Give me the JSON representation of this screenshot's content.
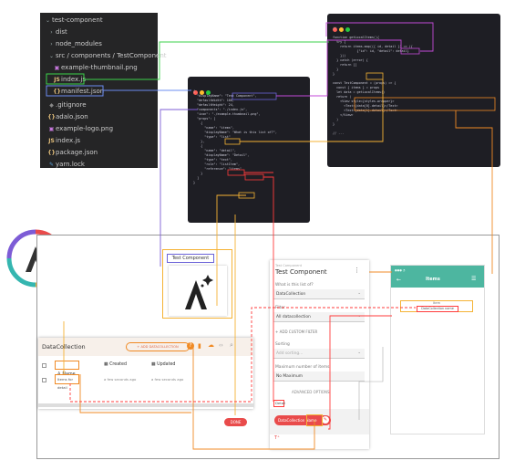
{
  "colors": {
    "teal": "#4db6a0",
    "orange": "#f08a24",
    "red": "#ff3b3b",
    "code_bg": "#1e1e24",
    "tree_bg": "#252526"
  },
  "file_tree": {
    "root": "test-component",
    "items": [
      {
        "label": "dist",
        "icon": "chevron-right"
      },
      {
        "label": "node_modules",
        "icon": "chevron-right"
      },
      {
        "label": "src / components / TestComponent",
        "icon": "chevron-down"
      },
      {
        "label": "example-thumbnail.png",
        "icon": "image"
      },
      {
        "label": "index.js",
        "icon": "js"
      },
      {
        "label": "manifest.json",
        "icon": "json"
      },
      {
        "label": ".gitignore",
        "icon": "git"
      },
      {
        "label": "adalo.json",
        "icon": "json"
      },
      {
        "label": "example-logo.png",
        "icon": "image"
      },
      {
        "label": "index.js",
        "icon": "js"
      },
      {
        "label": "package.json",
        "icon": "json"
      },
      {
        "label": "yarn.lock",
        "icon": "yarn"
      }
    ]
  },
  "manifest_code": [
    "{",
    "  \"displayName\": \"Test Component\",",
    "  \"defaultWidth\": 100,",
    "  \"defaultHeight\": 24,",
    "  \"components\": \"./index.js\",",
    "  \"icon\": \"./example-thumbnail.png\",",
    "  \"props\": [",
    "    {",
    "      \"name\": \"items\",",
    "      \"displayName\": \"What is this list of?\",",
    "      \"type\": \"list\"",
    "    },",
    "    {",
    "      \"name\": \"detail\",",
    "      \"displayName\": \"Detail\",",
    "      \"type\": \"text\",",
    "      \"role\": \"listItem\",",
    "      \"reference\": \"items\"",
    "    }",
    "  ]",
    "}"
  ],
  "index_code": [
    "// ...",
    "",
    "function getLocalItems(){",
    "  try {",
    "    return items.map(({ id, detail }) => ({",
    "             {\"id\": id, \"detail\": detail}",
    "    }))",
    "  } catch (error) {",
    "    return []",
    "  }",
    "}",
    "",
    "const TestComponent = (props) => {",
    "  const { items } = props",
    "  let data = getLocalItems()",
    "  return (",
    "    <View style={styles.wrapper}>",
    "      <Text>{data[0].detail}</Text>",
    "      <Text>{data[1].detail}</Text>",
    "    </View>",
    "  )",
    "}",
    "",
    "// ..."
  ],
  "thumbnail": {
    "caption": "Test Component"
  },
  "collection_panel": {
    "title": "DataCollection",
    "add_button": "+ ADD DATACOLLECTION",
    "columns": [
      "Name",
      "Created",
      "Updated"
    ],
    "rows": [
      {
        "name": "Items for detail",
        "created": "a few seconds ago",
        "updated": "a few seconds ago"
      }
    ],
    "done_button": "DONE"
  },
  "editor_panel": {
    "header_sub": "Test Component",
    "title": "Test Component",
    "list_label": "What is this list of?",
    "list_value": "DataCollection",
    "filter_label": "Filter",
    "filter_value": "All datacollection",
    "add_filter": "+ ADD CUSTOM FILTER",
    "sorting_label": "Sorting",
    "sorting_value": "Add sorting...",
    "max_label": "Maximum number of items",
    "max_value": "No Maximum",
    "advanced": "ADVANCED OPTIONS",
    "detail_label": "Detail",
    "chip": "DataCollection Name",
    "chip_tag": "T"
  },
  "phone": {
    "header_title": "Items",
    "line1": "Item",
    "line2": "DataCollection name"
  }
}
